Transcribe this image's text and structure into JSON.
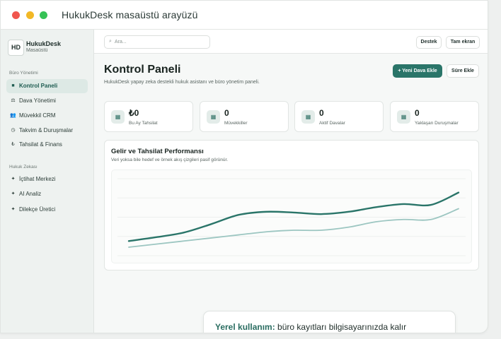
{
  "window": {
    "title": "HukukDesk masaüstü arayüzü"
  },
  "brand": {
    "logo": "HD",
    "name": "HukukDesk",
    "subtitle": "Masaüstü"
  },
  "sidebar": {
    "sections": [
      {
        "label": "Büro Yönetimi",
        "items": [
          {
            "label": "Kontrol Paneli",
            "icon": "dashboard-icon",
            "glyph": "■",
            "active": true
          },
          {
            "label": "Dava Yönetimi",
            "icon": "cases-icon",
            "glyph": "⚖",
            "active": false
          },
          {
            "label": "Müvekkil CRM",
            "icon": "clients-icon",
            "glyph": "👥",
            "active": false
          },
          {
            "label": "Takvim & Duruşmalar",
            "icon": "calendar-icon",
            "glyph": "◷",
            "active": false
          },
          {
            "label": "Tahsilat & Finans",
            "icon": "finance-icon",
            "glyph": "₺",
            "active": false
          }
        ]
      },
      {
        "label": "Hukuk Zekası",
        "items": [
          {
            "label": "İçtihat Merkezi",
            "icon": "sparkle-icon",
            "glyph": "✦",
            "active": false
          },
          {
            "label": "AI Analiz",
            "icon": "sparkle-icon",
            "glyph": "✦",
            "active": false
          },
          {
            "label": "Dilekçe Üretici",
            "icon": "sparkle-icon",
            "glyph": "✦",
            "active": false
          }
        ]
      }
    ]
  },
  "topbar": {
    "search_placeholder": "Ara...",
    "support_label": "Destek",
    "fullscreen_label": "Tam ekran"
  },
  "header": {
    "title": "Kontrol Paneli",
    "subtitle": "HukukDesk yapay zeka destekli hukuk asistanı ve büro yönetim paneli.",
    "new_case_label": "+ Yeni Dava Ekle",
    "add_time_label": "Süre Ekle"
  },
  "stats": [
    {
      "value": "₺0",
      "label": "Bu Ay Tahsilat",
      "icon": "grid-icon"
    },
    {
      "value": "0",
      "label": "Müvekkiller",
      "icon": "grid-icon"
    },
    {
      "value": "0",
      "label": "Aktif Davalar",
      "icon": "grid-icon"
    },
    {
      "value": "0",
      "label": "Yaklaşan Duruşmalar",
      "icon": "grid-icon"
    }
  ],
  "chart": {
    "title": "Gelir ve Tahsilat Performansı",
    "subtitle": "Veri yoksa bile hedef ve örnek akış çizgileri pasif görünür."
  },
  "chart_data": {
    "type": "line",
    "title": "Gelir ve Tahsilat Performansı",
    "xlabel": "",
    "ylabel": "",
    "grid": true,
    "legend": "none",
    "ylim": [
      0,
      100
    ],
    "x": [
      0,
      1,
      2,
      3,
      4,
      5,
      6,
      7,
      8,
      9,
      10,
      11,
      12
    ],
    "series": [
      {
        "color": "#2a7569",
        "values": [
          19,
          24,
          30,
          41,
          53,
          57,
          56,
          54,
          57,
          63,
          67,
          66,
          82
        ]
      },
      {
        "color": "#9cc6c1",
        "values": [
          11,
          15,
          19,
          23,
          27,
          31,
          33,
          33,
          37,
          44,
          47,
          47,
          61
        ]
      }
    ]
  },
  "toast": {
    "strong": "Yerel kullanım:",
    "text": " büro kayıtları bilgisayarınızda kalır"
  },
  "colors": {
    "accent": "#2a7569",
    "accent_light": "#9cc6c1",
    "sidebar_bg": "#eef2f0",
    "active_bg": "#dde9e5"
  }
}
